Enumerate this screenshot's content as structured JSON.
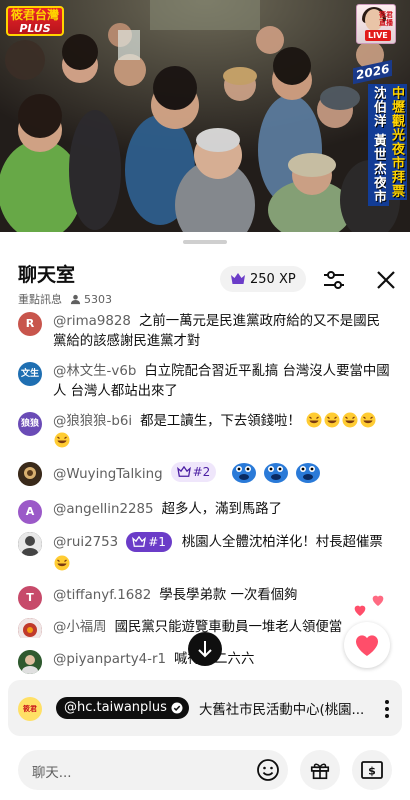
{
  "video": {
    "logo_line1": "筱君台灣",
    "logo_line2": "PLUS",
    "live_box_label": "筱君直播",
    "live_tag": "LIVE",
    "side_year": "2026",
    "side_text_left": "沈伯洋 黃世杰",
    "side_text_left2": "夜市",
    "side_text_right": "中壢觀光夜市拜票"
  },
  "chat": {
    "title": "聊天室",
    "mode": "重點訊息",
    "viewer_count": "5303",
    "xp_label": "250 XP",
    "input_placeholder": "聊天...",
    "colors": {
      "accent": "#6b3cc8",
      "secondary_text": "#606060",
      "panel": "#f2f2f2",
      "heart": "#ff4e6a"
    }
  },
  "messages": [
    {
      "author": "@rima9828",
      "avatar_text": "R",
      "avatar_color": "#c8554c",
      "text": "之前一萬元是民進黨政府給的又不是國民黨給的該感謝民進黨才對"
    },
    {
      "author": "@林文生-v6b",
      "avatar_text": "文生",
      "avatar_color": "#1f6fb2",
      "text": "白立院配合習近平亂搞 台灣沒人要當中國人 台灣人都站出來了"
    },
    {
      "author": "@狼狼狼-b6i",
      "avatar_text": "狼狼",
      "avatar_color": "#6a4bb6",
      "text": "都是工讀生，下去領錢啦！"
    },
    {
      "author": "@WuyingTalking",
      "avatar_text": "",
      "avatar_color": "#3a2a1a",
      "badge": "#2",
      "text": ""
    },
    {
      "author": "@angellin2285",
      "avatar_text": "A",
      "avatar_color": "#9b59c8",
      "text": "超多人，滿到馬路了"
    },
    {
      "author": "@rui2753",
      "avatar_text": "",
      "avatar_color": "#555555",
      "badge": "#1",
      "text": "桃園人全體沈柏洋化！村長超催票"
    },
    {
      "author": "@tiffanyf.1682",
      "avatar_text": "T",
      "avatar_color": "#c74a6a",
      "text": "學長學弟款 一次看個夠"
    },
    {
      "author": "@小福周",
      "avatar_text": "",
      "avatar_color": "#a04040",
      "text": "國民黨只能遊覽車動員一堆老人領便當"
    },
    {
      "author": "@piyanparty4-r1",
      "avatar_text": "",
      "avatar_color": "#3b6b3b",
      "text": "喊得二二六六"
    }
  ],
  "pinned": {
    "logo_text": "筱君",
    "author": "@hc.taiwanplus",
    "text": "大舊社市民活動中心(桃園..."
  },
  "icons": {
    "crown": "crown-icon",
    "viewers": "person-icon",
    "filter": "sliders-icon",
    "close": "close-icon",
    "scroll_down": "arrow-down-icon",
    "heart": "heart-icon",
    "more": "more-vert-icon",
    "emoji": "emoji-icon",
    "gift": "gift-icon",
    "super_chat": "dollar-icon"
  }
}
